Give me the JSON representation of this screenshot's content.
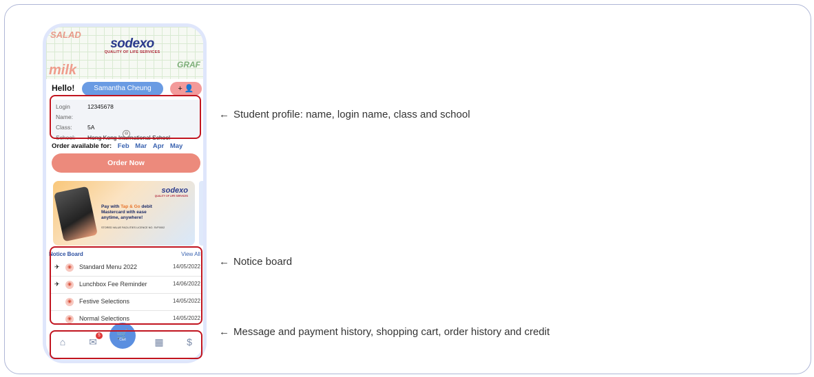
{
  "banner": {
    "logo_word": "sodexo",
    "logo_tagline": "QUALITY OF LIFE SERVICES",
    "doodle_words": [
      "SALAD",
      "milk",
      "GRAF"
    ]
  },
  "greeting": {
    "hello": "Hello!",
    "student_name": "Samantha Cheung",
    "add_button": "+ 👤"
  },
  "profile": {
    "login_label": "Login Name:",
    "login_value": "12345678",
    "class_label": "Class:",
    "class_value": "5A",
    "school_label": "School:",
    "school_value": "Hong Kong International School",
    "collapse_icon": "⊖"
  },
  "order": {
    "available_label": "Order available for:",
    "months": [
      "Feb",
      "Mar",
      "Apr",
      "May"
    ],
    "order_now": "Order Now"
  },
  "promo": {
    "logo_word": "sodexo",
    "logo_tagline": "QUALITY OF LIFE SERVICES",
    "line1_pre": "Pay with ",
    "line1_hl": "Tap & Go",
    "line1_post": " debit",
    "line2": "Mastercard with ease",
    "line3": "anytime, anywhere!",
    "fine_print": "STORED VALUE FACILITIES LICENCE NO. SVF0002"
  },
  "notice_board": {
    "title": "Notice Board",
    "view_all": "View All",
    "items": [
      {
        "pinned": true,
        "title": "Standard Menu 2022",
        "date": "14/05/2022"
      },
      {
        "pinned": true,
        "title": "Lunchbox Fee Reminder",
        "date": "14/06/2022"
      },
      {
        "pinned": false,
        "title": "Festive Selections",
        "date": "14/05/2022"
      },
      {
        "pinned": false,
        "title": "Normal Selections",
        "date": "14/05/2022"
      }
    ]
  },
  "tabbar": {
    "home_icon": "home-icon",
    "message_badge": "5",
    "cart_label": "Cart",
    "order_history_icon": "calendar-icon",
    "credit_icon": "dollar-icon"
  },
  "annotations": {
    "profile": "Student profile: name, login name, class and school",
    "notice": "Notice board",
    "bottom": "Message and payment history, shopping cart, order history and credit",
    "arrow": "←"
  },
  "colors": {
    "highlight": "#c1141f",
    "order_button": "#ec8a7c",
    "name_pill": "#6a9be3",
    "cart_button": "#5b8fe0"
  }
}
